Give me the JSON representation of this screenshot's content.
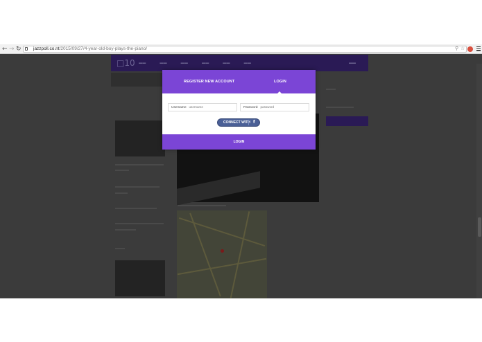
{
  "browser": {
    "back_icon": "arrow-left",
    "forward_icon": "arrow-right",
    "reload_icon": "refresh",
    "url_domain": "jazzpoll.co.nt",
    "url_path": "/2015/09/27/4-year-old-boy-plays-the-piano/"
  },
  "modal": {
    "tab_register": "REGISTER NEW ACCOUNT",
    "tab_login": "LOGIN",
    "username_label": "Username:",
    "username_placeholder": "username",
    "password_label": "Password:",
    "password_placeholder": "password",
    "connect_label": "CONNECT WITH",
    "connect_icon": "f",
    "footer_login": "LOGIN"
  },
  "colors": {
    "accent": "#7b45d6",
    "facebook": "#4a5f96"
  }
}
